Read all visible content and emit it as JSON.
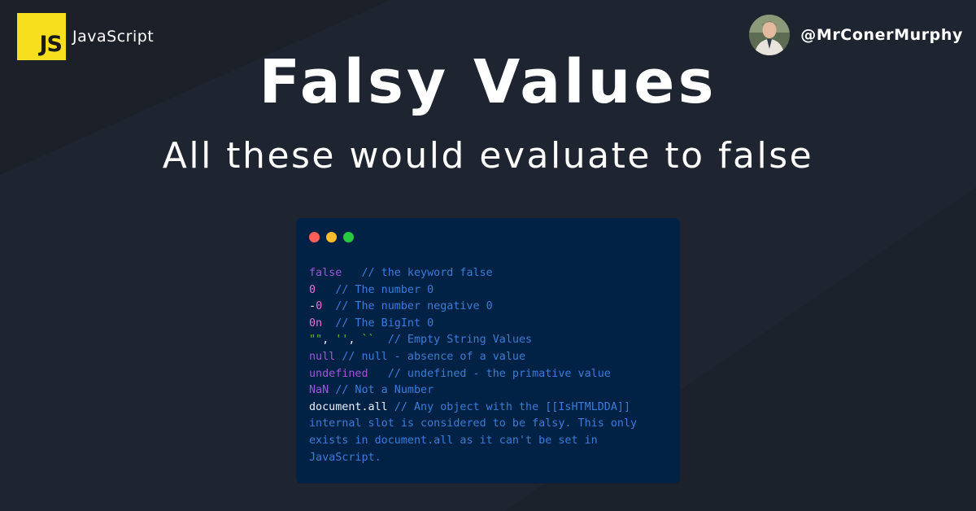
{
  "brand": {
    "logo_text": "JS",
    "name": "JavaScript"
  },
  "author": {
    "handle": "@MrConerMurphy"
  },
  "title": "Falsy Values",
  "subtitle": "All these would evaluate to false",
  "icons": {
    "window_controls": [
      "close-dot-icon",
      "minimize-dot-icon",
      "maximize-dot-icon"
    ]
  },
  "colors": {
    "background": "#1b2029",
    "js_yellow": "#f7df1e",
    "code_bg": "#012244",
    "dot_red": "#ff5f56",
    "dot_yellow": "#ffbd2e",
    "dot_green": "#27c93f",
    "keyword": "#9b59d6",
    "number": "#e372d8",
    "string": "#57c52f",
    "comment": "#3a7cd8",
    "identifier": "#e8f0ff"
  },
  "code": {
    "lines": [
      {
        "tokens": [
          {
            "t": "false",
            "c": "keyword"
          },
          {
            "t": "   "
          },
          {
            "t": "// the keyword false",
            "c": "comment"
          }
        ]
      },
      {
        "tokens": [
          {
            "t": "0",
            "c": "number"
          },
          {
            "t": "   "
          },
          {
            "t": "// The number 0",
            "c": "comment"
          }
        ]
      },
      {
        "tokens": [
          {
            "t": "-",
            "c": "identifier"
          },
          {
            "t": "0",
            "c": "number"
          },
          {
            "t": "  "
          },
          {
            "t": "// The number negative 0",
            "c": "comment"
          }
        ]
      },
      {
        "tokens": [
          {
            "t": "0n",
            "c": "number"
          },
          {
            "t": "  "
          },
          {
            "t": "// The BigInt 0",
            "c": "comment"
          }
        ]
      },
      {
        "tokens": [
          {
            "t": "\"\"",
            "c": "string"
          },
          {
            "t": ", ",
            "c": "identifier"
          },
          {
            "t": "''",
            "c": "string"
          },
          {
            "t": ", ",
            "c": "identifier"
          },
          {
            "t": "``",
            "c": "string"
          },
          {
            "t": "  "
          },
          {
            "t": "// Empty String Values",
            "c": "comment"
          }
        ]
      },
      {
        "tokens": [
          {
            "t": "null",
            "c": "keyword"
          },
          {
            "t": " "
          },
          {
            "t": "// null - absence of a value",
            "c": "comment"
          }
        ]
      },
      {
        "tokens": [
          {
            "t": "undefined",
            "c": "keyword"
          },
          {
            "t": "   "
          },
          {
            "t": "// undefined - the primative value",
            "c": "comment"
          }
        ]
      },
      {
        "tokens": [
          {
            "t": "NaN",
            "c": "keyword"
          },
          {
            "t": " "
          },
          {
            "t": "// Not a Number",
            "c": "comment"
          }
        ]
      },
      {
        "tokens": [
          {
            "t": "document.all",
            "c": "identifier"
          },
          {
            "t": " "
          },
          {
            "t": "// Any object with the [[IsHTMLDDA]]",
            "c": "comment"
          }
        ]
      },
      {
        "tokens": [
          {
            "t": "internal slot is considered to be falsy. This only",
            "c": "comment"
          }
        ]
      },
      {
        "tokens": [
          {
            "t": "exists in document.all as it can't be set in",
            "c": "comment"
          }
        ]
      },
      {
        "tokens": [
          {
            "t": "JavaScript.",
            "c": "comment"
          }
        ]
      }
    ]
  }
}
